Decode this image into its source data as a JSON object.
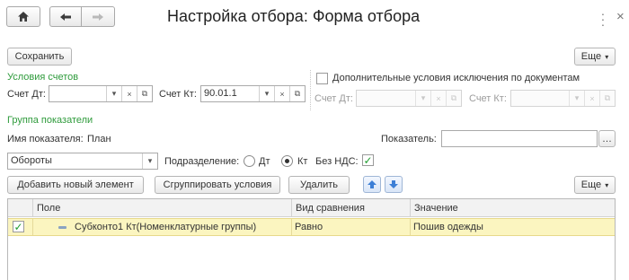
{
  "window": {
    "title": "Настройка отбора: Форма отбора"
  },
  "toolbar": {
    "save": "Сохранить",
    "more": "Еще"
  },
  "accounts_section": {
    "heading": "Условия счетов"
  },
  "debit": {
    "label": "Счет Дт:",
    "value": ""
  },
  "credit": {
    "label": "Счет Кт:",
    "value": "90.01.1"
  },
  "exclusion": {
    "checkbox_label": "Дополнительные условия исключения по документам",
    "debit_label": "Счет Дт:",
    "credit_label": "Счет Кт:"
  },
  "indicator_group": {
    "heading": "Группа показатели",
    "name_label": "Имя показателя:",
    "name_value": "План",
    "indicator_label": "Показатель:",
    "indicator_value": ""
  },
  "turnover": {
    "value": "Обороты"
  },
  "division": {
    "label": "Подразделение:",
    "option_dt": "Дт",
    "option_kt": "Кт",
    "selected": "Кт"
  },
  "no_vat": {
    "label": "Без НДС:",
    "checked": true
  },
  "table_toolbar": {
    "add": "Добавить новый элемент",
    "group": "Сгруппировать условия",
    "delete": "Удалить",
    "more": "Еще"
  },
  "table": {
    "columns": [
      "Поле",
      "Вид сравнения",
      "Значение"
    ],
    "rows": [
      {
        "checked": true,
        "field": "Субконто1 Кт(Номенклатурные группы)",
        "comparison": "Равно",
        "value": "Пошив одежды"
      }
    ]
  },
  "icons": [
    "home-icon",
    "back-arrow-icon",
    "forward-arrow-icon",
    "more-vertical-icon",
    "dropdown-icon",
    "clear-icon",
    "open-icon",
    "checkmark-icon",
    "move-up-icon",
    "move-down-icon",
    "minus-icon"
  ]
}
